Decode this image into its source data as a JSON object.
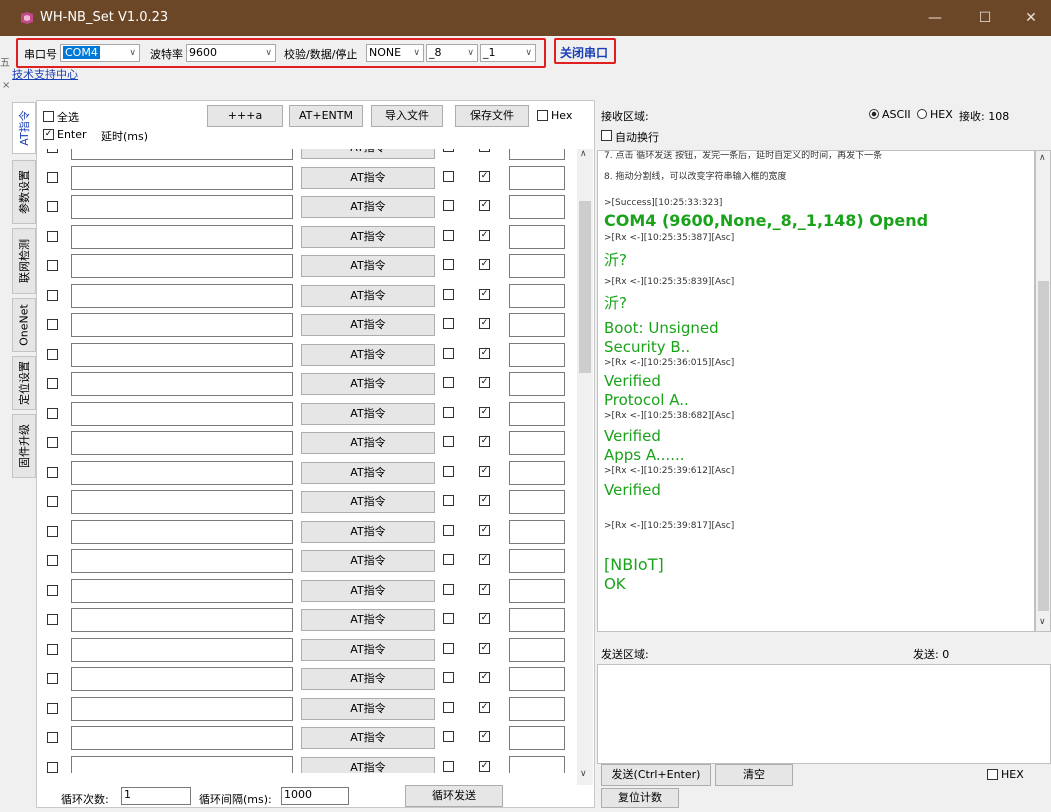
{
  "window": {
    "title": "WH-NB_Set V1.0.23",
    "controls": [
      "—",
      "☐",
      "✕"
    ]
  },
  "toolbar": {
    "port_label": "串口号",
    "port_value": "COM4",
    "baud_label": "波特率",
    "baud_value": "9600",
    "parity_label": "校验/数据/停止",
    "parity_value": "NONE",
    "data_value": "_8",
    "stop_value": "_1",
    "close_port": "关闭串口",
    "support_link": "技术支持中心",
    "stray": "×"
  },
  "vtabs": [
    "AT指令",
    "参数设置",
    "联网检测",
    "OneNet",
    "定位设置",
    "固件升级"
  ],
  "left": {
    "select_all": "全选",
    "enter": "Enter",
    "delay": "延时(ms)",
    "btn_plus": "+++a",
    "btn_entm": "AT+ENTM",
    "btn_import": "导入文件",
    "btn_save": "保存文件",
    "hex": "Hex",
    "row_button": "AT指令",
    "loop_count_label": "循环次数:",
    "loop_count": "1",
    "loop_interval_label": "循环间隔(ms):",
    "loop_interval": "1000",
    "loop_send": "循环发送"
  },
  "right": {
    "recv_label": "接收区域:",
    "ascii": "ASCII",
    "hex": "HEX",
    "recv_count": "接收: 108",
    "auto_wrap": "自动换行",
    "recv_lines": [
      "7. 点击 循环发送 按钮，发完一条后，延时自定义的时间，再发下一条",
      "8. 拖动分割线，可以改变字符串输入框的宽度",
      ">[Success][10:25:33:323]",
      "COM4 (9600,None,_8,_1,148) Opend",
      ">[Rx <-][10:25:35:387][Asc]",
      "沂?",
      ">[Rx <-][10:25:35:839][Asc]",
      "沂?",
      "Boot: Unsigned",
      "Security B..",
      ">[Rx <-][10:25:36:015][Asc]",
      "Verified",
      "Protocol A..",
      ">[Rx <-][10:25:38:682][Asc]",
      "Verified",
      "Apps A......",
      ">[Rx <-][10:25:39:612][Asc]",
      "Verified",
      ">[Rx <-][10:25:39:817][Asc]",
      "[NBIoT]",
      "OK"
    ],
    "send_label": "发送区域:",
    "send_count": "发送: 0",
    "send_btn": "发送(Ctrl+Enter)",
    "clear_btn": "清空",
    "hex_label": "HEX",
    "reset_btn": "复位计数"
  },
  "colors": {
    "titlebar": "#6b4728",
    "green_text": "#1aa31a",
    "highlight": "#e02020",
    "link": "#1a3fb5"
  }
}
